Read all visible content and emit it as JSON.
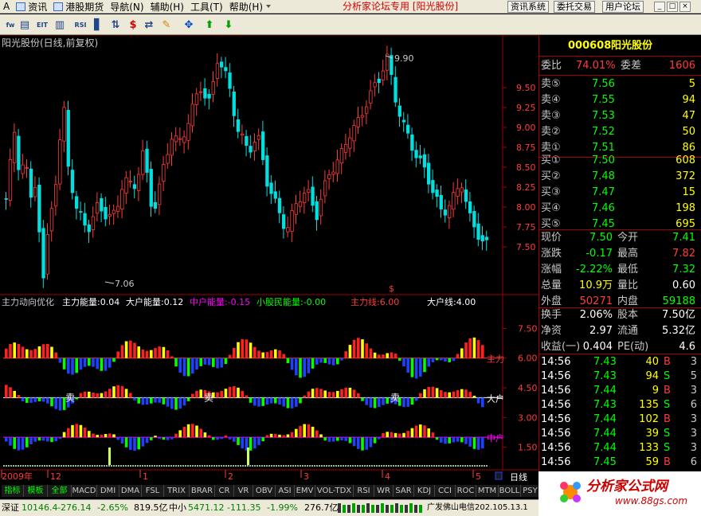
{
  "menu": [
    {
      "label": "A",
      "icon": "",
      "caret": false
    },
    {
      "label": "资讯",
      "icon": "news-icon",
      "caret": false
    },
    {
      "label": "港股期货",
      "icon": "grid-icon",
      "caret": false
    },
    {
      "label": "导航(N)",
      "icon": "",
      "caret": false
    },
    {
      "label": "辅助(H)",
      "icon": "",
      "caret": false
    },
    {
      "label": "工具(T)",
      "icon": "",
      "caret": false
    },
    {
      "label": "帮助(H)",
      "icon": "",
      "caret": true
    }
  ],
  "forum_title": "分析家论坛专用 [阳光股份]",
  "top_buttons": [
    "资讯系统",
    "委托交易",
    "用户论坛"
  ],
  "window_buttons": [
    "_",
    "□",
    "×"
  ],
  "toolbar_icons": [
    "fw-icon",
    "chart-list-icon",
    "eit-icon",
    "bars-icon",
    "rsi-icon",
    "kline-icon",
    "sort-icon",
    "dollar-icon",
    "swap-icon",
    "pen-icon",
    "crosshair-icon",
    "up-arrow-icon",
    "down-arrow-icon"
  ],
  "colors": {
    "up": "#ff3b3b",
    "down": "#00e0e0",
    "panel_border": "#a00000",
    "yellow": "#ffff00",
    "green": "#00ff00",
    "blue": "#2040ff",
    "magenta": "#ff00ff"
  },
  "kline": {
    "label": "阳光股份(日线,前复权)",
    "high_note": "9.90",
    "low_note": "7.06",
    "y_ticks": [
      "9.50",
      "9.25",
      "9.00",
      "8.75",
      "8.50",
      "8.25",
      "8.00",
      "7.75",
      "7.50"
    ],
    "marker": "$"
  },
  "indicator": {
    "name": "主力动向优化",
    "params": [
      {
        "label": "主力能量:0.04",
        "color": "#ffffff"
      },
      {
        "label": "大户能量:0.12",
        "color": "#ffffff"
      },
      {
        "label": "中户能量:-0.15",
        "color": "#ff00ff"
      },
      {
        "label": "小股民能量:-0.00",
        "color": "#00ff00"
      },
      {
        "label": "主力线:6.00",
        "color": "#ff3b3b"
      },
      {
        "label": "大户线:4.00",
        "color": "#ffffff"
      }
    ],
    "y_ticks": [
      "7.50",
      "6.00",
      "4.50",
      "3.00",
      "1.50"
    ],
    "line_labels": [
      "主力",
      "大户",
      "中户"
    ],
    "sell_labels": [
      "卖",
      "卖",
      "卖"
    ]
  },
  "x_axis": {
    "labels": [
      "2009年",
      "12",
      "1",
      "2",
      "3",
      "4",
      "5"
    ],
    "period": "日线"
  },
  "quote": {
    "code": "000608",
    "name": "阳光股份",
    "weibi_label": "委比",
    "weibi": "74.01%",
    "weicha_label": "委差",
    "weicha": "1606",
    "sell": [
      {
        "label": "卖⑤",
        "price": "7.56",
        "vol": "5"
      },
      {
        "label": "卖④",
        "price": "7.55",
        "vol": "94"
      },
      {
        "label": "卖③",
        "price": "7.53",
        "vol": "47"
      },
      {
        "label": "卖②",
        "price": "7.52",
        "vol": "50"
      },
      {
        "label": "卖①",
        "price": "7.51",
        "vol": "86"
      }
    ],
    "buy": [
      {
        "label": "买①",
        "price": "7.50",
        "vol": "608"
      },
      {
        "label": "买②",
        "price": "7.48",
        "vol": "372"
      },
      {
        "label": "买③",
        "price": "7.47",
        "vol": "15"
      },
      {
        "label": "买④",
        "price": "7.46",
        "vol": "198"
      },
      {
        "label": "买⑤",
        "price": "7.45",
        "vol": "695"
      }
    ],
    "stats": [
      {
        "l1": "现价",
        "v1": "7.50",
        "c1": "#00ff00",
        "l2": "今开",
        "v2": "7.41",
        "c2": "#00ff00"
      },
      {
        "l1": "涨跌",
        "v1": "-0.17",
        "c1": "#00ff00",
        "l2": "最高",
        "v2": "7.82",
        "c2": "#ff3b3b"
      },
      {
        "l1": "涨幅",
        "v1": "-2.22%",
        "c1": "#00ff00",
        "l2": "最低",
        "v2": "7.32",
        "c2": "#00ff00"
      },
      {
        "l1": "总量",
        "v1": "10.9万",
        "c1": "#ffff00",
        "l2": "量比",
        "v2": "0.60",
        "c2": "#ffffff"
      },
      {
        "l1": "外盘",
        "v1": "50271",
        "c1": "#ff3b3b",
        "l2": "内盘",
        "v2": "59188",
        "c2": "#00ff00"
      }
    ],
    "finance": [
      {
        "l1": "换手",
        "v1": "2.06%",
        "l2": "股本",
        "v2": "7.50亿"
      },
      {
        "l1": "净资",
        "v1": "2.97",
        "l2": "流通",
        "v2": "5.32亿"
      },
      {
        "l1": "收益(一)",
        "v1": "0.404",
        "l2": "PE(动)",
        "v2": "4.6"
      }
    ],
    "ticks": [
      {
        "time": "14:56",
        "price": "7.43",
        "vol": "40",
        "bs": "B",
        "n": "3"
      },
      {
        "time": "14:56",
        "price": "7.43",
        "vol": "94",
        "bs": "S",
        "n": "5"
      },
      {
        "time": "14:56",
        "price": "7.44",
        "vol": "9",
        "bs": "B",
        "n": "3"
      },
      {
        "time": "14:56",
        "price": "7.43",
        "vol": "135",
        "bs": "S",
        "n": "6"
      },
      {
        "time": "14:56",
        "price": "7.44",
        "vol": "102",
        "bs": "B",
        "n": "3"
      },
      {
        "time": "14:56",
        "price": "7.44",
        "vol": "39",
        "bs": "S",
        "n": "3"
      },
      {
        "time": "14:56",
        "price": "7.44",
        "vol": "133",
        "bs": "S",
        "n": "3"
      },
      {
        "time": "14:56",
        "price": "7.45",
        "vol": "59",
        "bs": "B",
        "n": "6"
      }
    ]
  },
  "tabs": [
    "指标",
    "模板",
    "全部",
    "MACD",
    "DMI",
    "DMA",
    "FSL",
    "TRIX",
    "BRAR",
    "CR",
    "VR",
    "OBV",
    "ASI",
    "EMV",
    "VOL-TDX",
    "RSI",
    "WR",
    "SAR",
    "KDJ",
    "CCI",
    "ROC",
    "MTM",
    "BOLL",
    "PSY"
  ],
  "status": {
    "sz_label": "深证",
    "sz_index": "10146.4",
    "sz_change": "-276.14",
    "sz_pct": "-2.65%",
    "sz_amount": "819.5亿",
    "zx_label": "中小",
    "zx_index": "5471.12",
    "zx_change": "-111.35",
    "zx_pct": "-1.99%",
    "zx_amount": "276.7亿",
    "server": "广发佛山电信202.105.13.1"
  },
  "logo": {
    "name": "分析家公式网",
    "url": "www.88gs.com"
  }
}
